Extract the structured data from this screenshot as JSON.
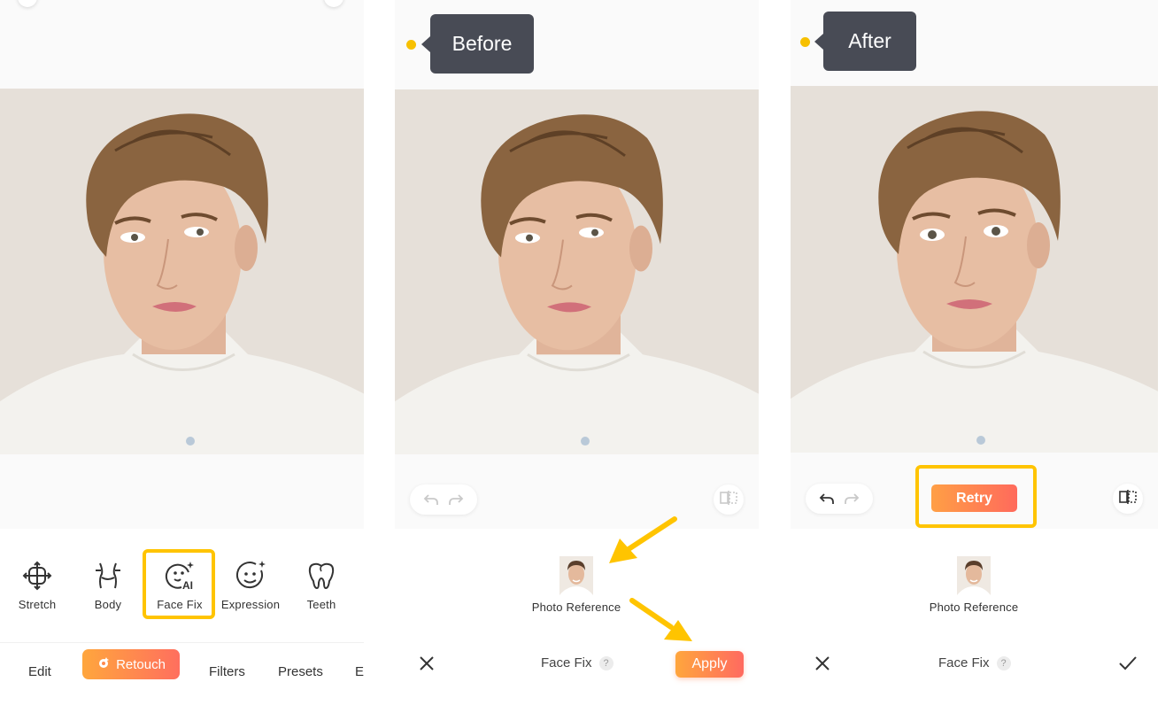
{
  "colors": {
    "accent_gradient_start": "#ffa63d",
    "accent_gradient_end": "#ff6a60",
    "highlight": "#ffc400",
    "tooltip_bg": "#484b55",
    "photo_bg": "#e6e0d9"
  },
  "panel1": {
    "tools": [
      {
        "label": "Stretch",
        "icon": "stretch-icon"
      },
      {
        "label": "Body",
        "icon": "body-icon"
      },
      {
        "label": "Face Fix",
        "icon": "face-fix-ai-icon",
        "selected": true
      },
      {
        "label": "Expression",
        "icon": "expression-icon"
      },
      {
        "label": "Teeth",
        "icon": "teeth-icon"
      }
    ],
    "nav": {
      "edit": "Edit",
      "retouch": "Retouch",
      "filters": "Filters",
      "presets": "Presets",
      "partial": "E"
    }
  },
  "panel2": {
    "tooltip": "Before",
    "reference_label": "Photo Reference",
    "title": "Face Fix",
    "help": "?",
    "apply": "Apply"
  },
  "panel3": {
    "tooltip": "After",
    "retry": "Retry",
    "reference_label": "Photo Reference",
    "title": "Face Fix",
    "help": "?"
  }
}
